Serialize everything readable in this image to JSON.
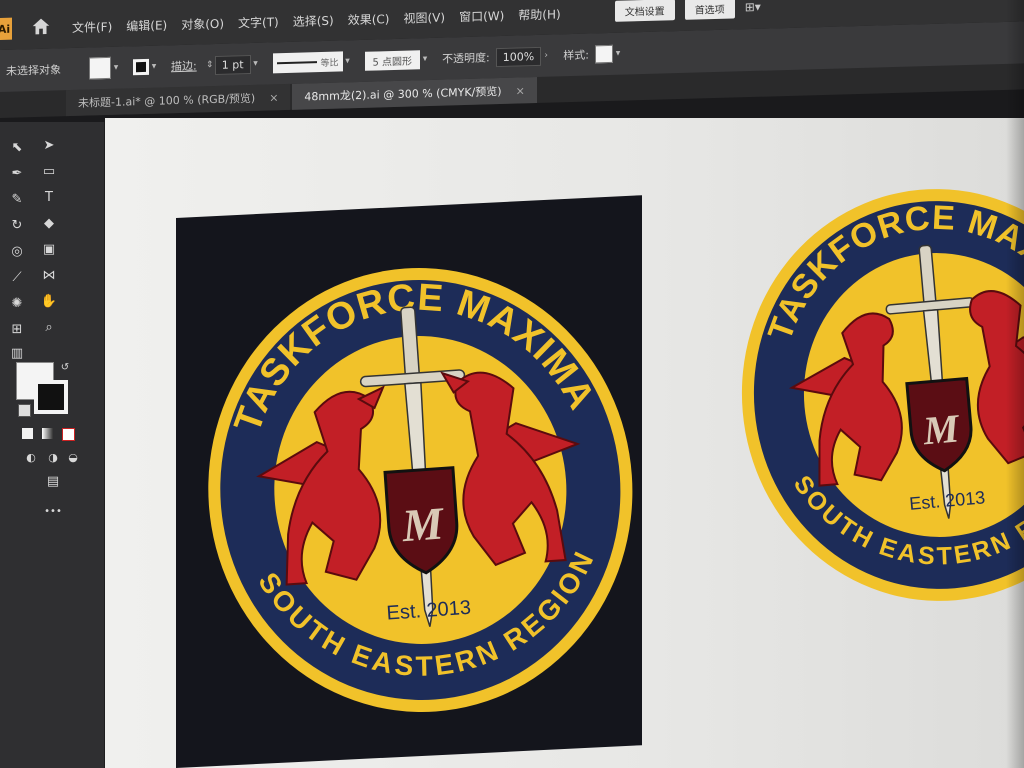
{
  "app": {
    "logo": "Ai",
    "home_icon": "home-icon"
  },
  "menu": [
    "文件(F)",
    "编辑(E)",
    "对象(O)",
    "文字(T)",
    "选择(S)",
    "效果(C)",
    "视图(V)",
    "窗口(W)",
    "帮助(H)"
  ],
  "menubar_right": {
    "doc_setup": "文档设置",
    "prefs": "首选项"
  },
  "control": {
    "selection_status": "未选择对象",
    "stroke_label": "描边:",
    "stroke_weight": "1 pt",
    "stroke_profile": "等比",
    "brush": "5 点圆形",
    "opacity_label": "不透明度:",
    "opacity": "100%",
    "style_label": "样式:"
  },
  "tabs": [
    {
      "label": "未标题-1.ai* @ 100 % (RGB/预览)",
      "close": "×"
    },
    {
      "label": "48mm龙(2).ai @ 300 % (CMYK/预览)",
      "close": "×"
    }
  ],
  "badge": {
    "top_text": "TASKFORCE MAXIMA",
    "bottom_text": "SOUTH EASTERN REGION",
    "est": "Est. 2013",
    "monogram": "M",
    "colors": {
      "navy": "#1d2c58",
      "gold": "#f1c22a",
      "red": "#c21f26",
      "dark": "#14151c"
    }
  },
  "tools": {
    "more": "•••"
  }
}
